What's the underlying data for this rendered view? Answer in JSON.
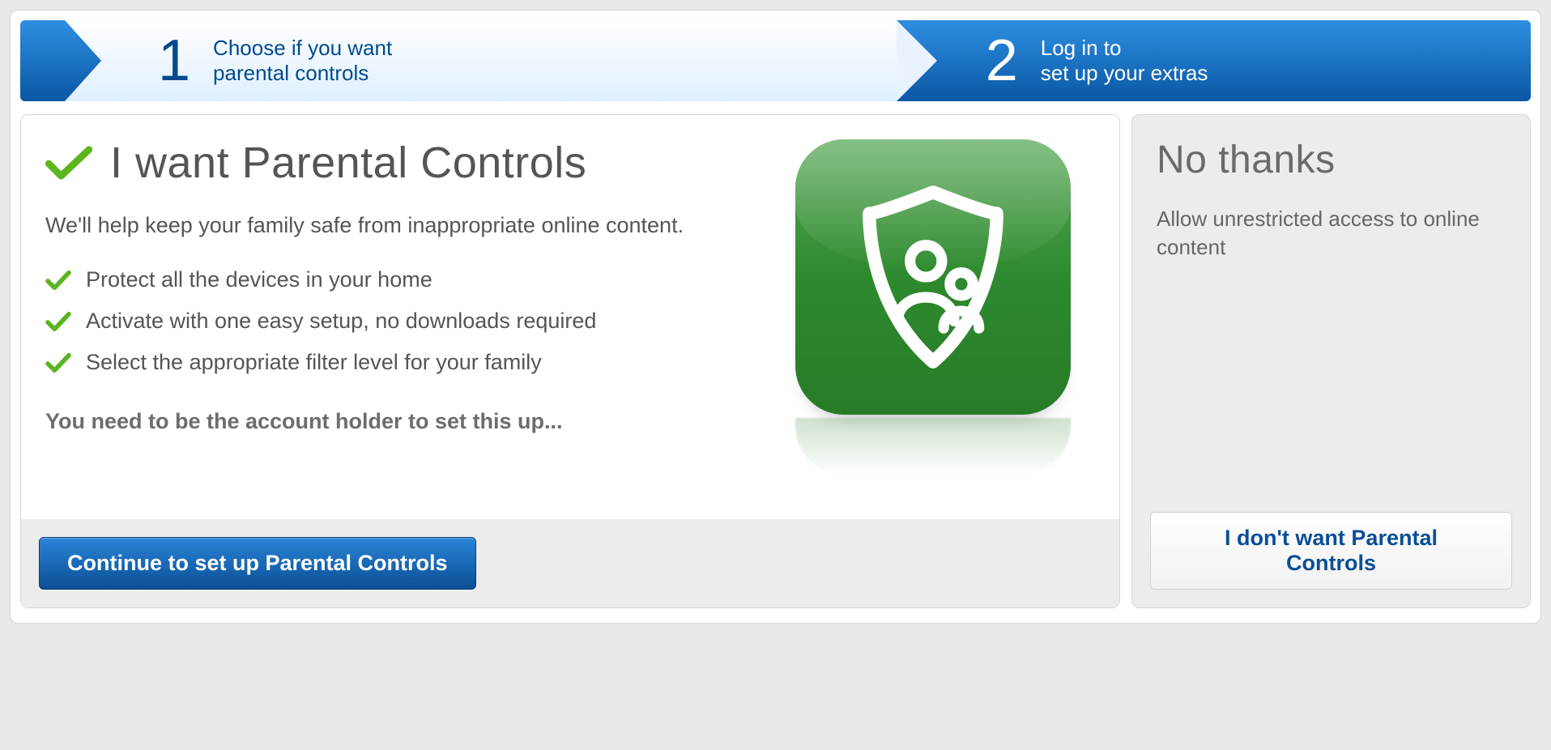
{
  "steps": {
    "s1": {
      "num": "1",
      "line1": "Choose if you want",
      "line2": "parental controls"
    },
    "s2": {
      "num": "2",
      "line1": "Log in to",
      "line2": "set up your extras"
    }
  },
  "main": {
    "title": "I want Parental Controls",
    "lead": "We'll help keep your family safe from inappropriate online content.",
    "features": {
      "f0": "Protect all the devices in your home",
      "f1": "Activate with one easy setup, no downloads required",
      "f2": "Select the appropriate filter level for your family"
    },
    "note": "You need to be the account holder to set this up...",
    "cta": "Continue to set up Parental Controls"
  },
  "side": {
    "title": "No thanks",
    "lead": "Allow unrestricted access to online content",
    "cta": "I don't want Parental Controls"
  }
}
